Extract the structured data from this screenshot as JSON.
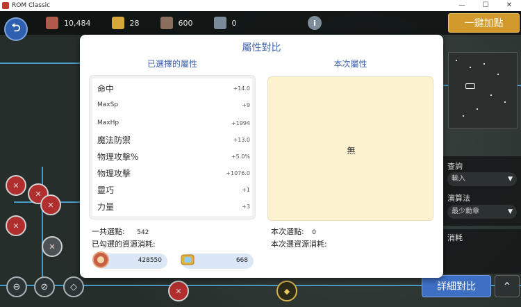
{
  "window": {
    "title": "ROM Classic",
    "controls": [
      "—",
      "☐",
      "✕"
    ]
  },
  "resources": [
    {
      "name": "medal",
      "value": "10,484",
      "color": "#b05a4a"
    },
    {
      "name": "gem",
      "value": "28",
      "color": "#d6a73a"
    },
    {
      "name": "bag",
      "value": "600",
      "color": "#8a6d5b"
    },
    {
      "name": "lockbag",
      "value": "0",
      "color": "#7a8a99"
    }
  ],
  "buttons": {
    "one_click": "一鍵加點",
    "detail_compare": "詳細對比",
    "info": "i"
  },
  "right_panel": {
    "query_label": "查詢",
    "query_value": "輸入",
    "algo_label": "演算法",
    "algo_value": "最少勳章",
    "cost_label": "消耗"
  },
  "modal": {
    "title": "屬性對比",
    "selected_header": "已選擇的屬性",
    "current_header": "本次屬性",
    "attributes": [
      {
        "name": "命中",
        "value": "+14.0"
      },
      {
        "name": "MaxSp",
        "value": "+9"
      },
      {
        "name": "MaxHp",
        "value": "+1994"
      },
      {
        "name": "魔法防禦",
        "value": "+13.0"
      },
      {
        "name": "物理攻擊%",
        "value": "+5.0%"
      },
      {
        "name": "物理攻擊",
        "value": "+1076.0"
      },
      {
        "name": "靈巧",
        "value": "+1"
      },
      {
        "name": "力量",
        "value": "+3"
      }
    ],
    "current_none": "無",
    "total_points_label": "一共選點:",
    "total_points_value": "542",
    "checked_cost_label": "已勾選的資源消耗:",
    "cost_medal": "428550",
    "cost_gem": "668",
    "current_points_label": "本次選點:",
    "current_points_value": "0",
    "current_cost_label": "本次選資源消耗:"
  },
  "colors": {
    "accent_blue": "#3f64a8",
    "gold_button": "#d29a2d",
    "detail_button": "#3d6fc4",
    "node_red": "#b02e2e"
  }
}
